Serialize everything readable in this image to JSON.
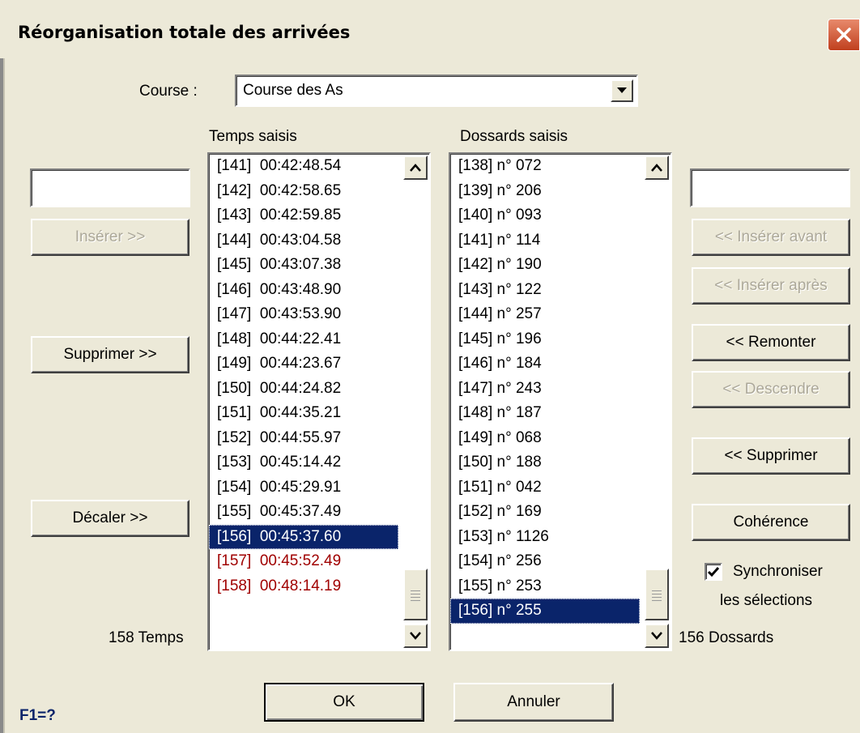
{
  "window": {
    "title": "Réorganisation totale des arrivées",
    "help_hint": "F1=?"
  },
  "course": {
    "label": "Course :",
    "selected": "Course des As"
  },
  "times": {
    "header": "Temps saisis",
    "count_label": "158 Temps",
    "items": [
      {
        "text": "[141]  00:42:48.54",
        "state": "normal"
      },
      {
        "text": "[142]  00:42:58.65",
        "state": "normal"
      },
      {
        "text": "[143]  00:42:59.85",
        "state": "normal"
      },
      {
        "text": "[144]  00:43:04.58",
        "state": "normal"
      },
      {
        "text": "[145]  00:43:07.38",
        "state": "normal"
      },
      {
        "text": "[146]  00:43:48.90",
        "state": "normal"
      },
      {
        "text": "[147]  00:43:53.90",
        "state": "normal"
      },
      {
        "text": "[148]  00:44:22.41",
        "state": "normal"
      },
      {
        "text": "[149]  00:44:23.67",
        "state": "normal"
      },
      {
        "text": "[150]  00:44:24.82",
        "state": "normal"
      },
      {
        "text": "[151]  00:44:35.21",
        "state": "normal"
      },
      {
        "text": "[152]  00:44:55.97",
        "state": "normal"
      },
      {
        "text": "[153]  00:45:14.42",
        "state": "normal"
      },
      {
        "text": "[154]  00:45:29.91",
        "state": "normal"
      },
      {
        "text": "[155]  00:45:37.49",
        "state": "normal"
      },
      {
        "text": "[156]  00:45:37.60",
        "state": "selected"
      },
      {
        "text": "[157]  00:45:52.49",
        "state": "unmatched"
      },
      {
        "text": "[158]  00:48:14.19",
        "state": "unmatched"
      }
    ],
    "input_value": "",
    "buttons": {
      "insert": "Insérer >>",
      "delete": "Supprimer >>",
      "shift": "Décaler >>"
    }
  },
  "bibs": {
    "header": "Dossards saisis",
    "count_label": "156 Dossards",
    "items": [
      {
        "text": "[138] n° 072",
        "state": "normal"
      },
      {
        "text": "[139] n° 206",
        "state": "normal"
      },
      {
        "text": "[140] n° 093",
        "state": "normal"
      },
      {
        "text": "[141] n° 114",
        "state": "normal"
      },
      {
        "text": "[142] n° 190",
        "state": "normal"
      },
      {
        "text": "[143] n° 122",
        "state": "normal"
      },
      {
        "text": "[144] n° 257",
        "state": "normal"
      },
      {
        "text": "[145] n° 196",
        "state": "normal"
      },
      {
        "text": "[146] n° 184",
        "state": "normal"
      },
      {
        "text": "[147] n° 243",
        "state": "normal"
      },
      {
        "text": "[148] n° 187",
        "state": "normal"
      },
      {
        "text": "[149] n° 068",
        "state": "normal"
      },
      {
        "text": "[150] n° 188",
        "state": "normal"
      },
      {
        "text": "[151] n° 042",
        "state": "normal"
      },
      {
        "text": "[152] n° 169",
        "state": "normal"
      },
      {
        "text": "[153] n° 1126",
        "state": "normal"
      },
      {
        "text": "[154] n° 256",
        "state": "normal"
      },
      {
        "text": "[155] n° 253",
        "state": "normal"
      },
      {
        "text": "[156] n° 255",
        "state": "selected"
      }
    ],
    "input_value": "",
    "buttons": {
      "insert_before": "<< Insérer avant",
      "insert_after": "<< Insérer après",
      "move_up": "<<  Remonter",
      "move_down": "<< Descendre",
      "delete": "<< Supprimer",
      "coherence": "Cohérence"
    }
  },
  "sync": {
    "label_line1": "Synchroniser",
    "label_line2": "les sélections",
    "checked": true
  },
  "footer": {
    "ok": "OK",
    "cancel": "Annuler"
  },
  "colors": {
    "selection": "#0a246a",
    "unmatched": "#a00000",
    "face": "#ece9d8"
  }
}
